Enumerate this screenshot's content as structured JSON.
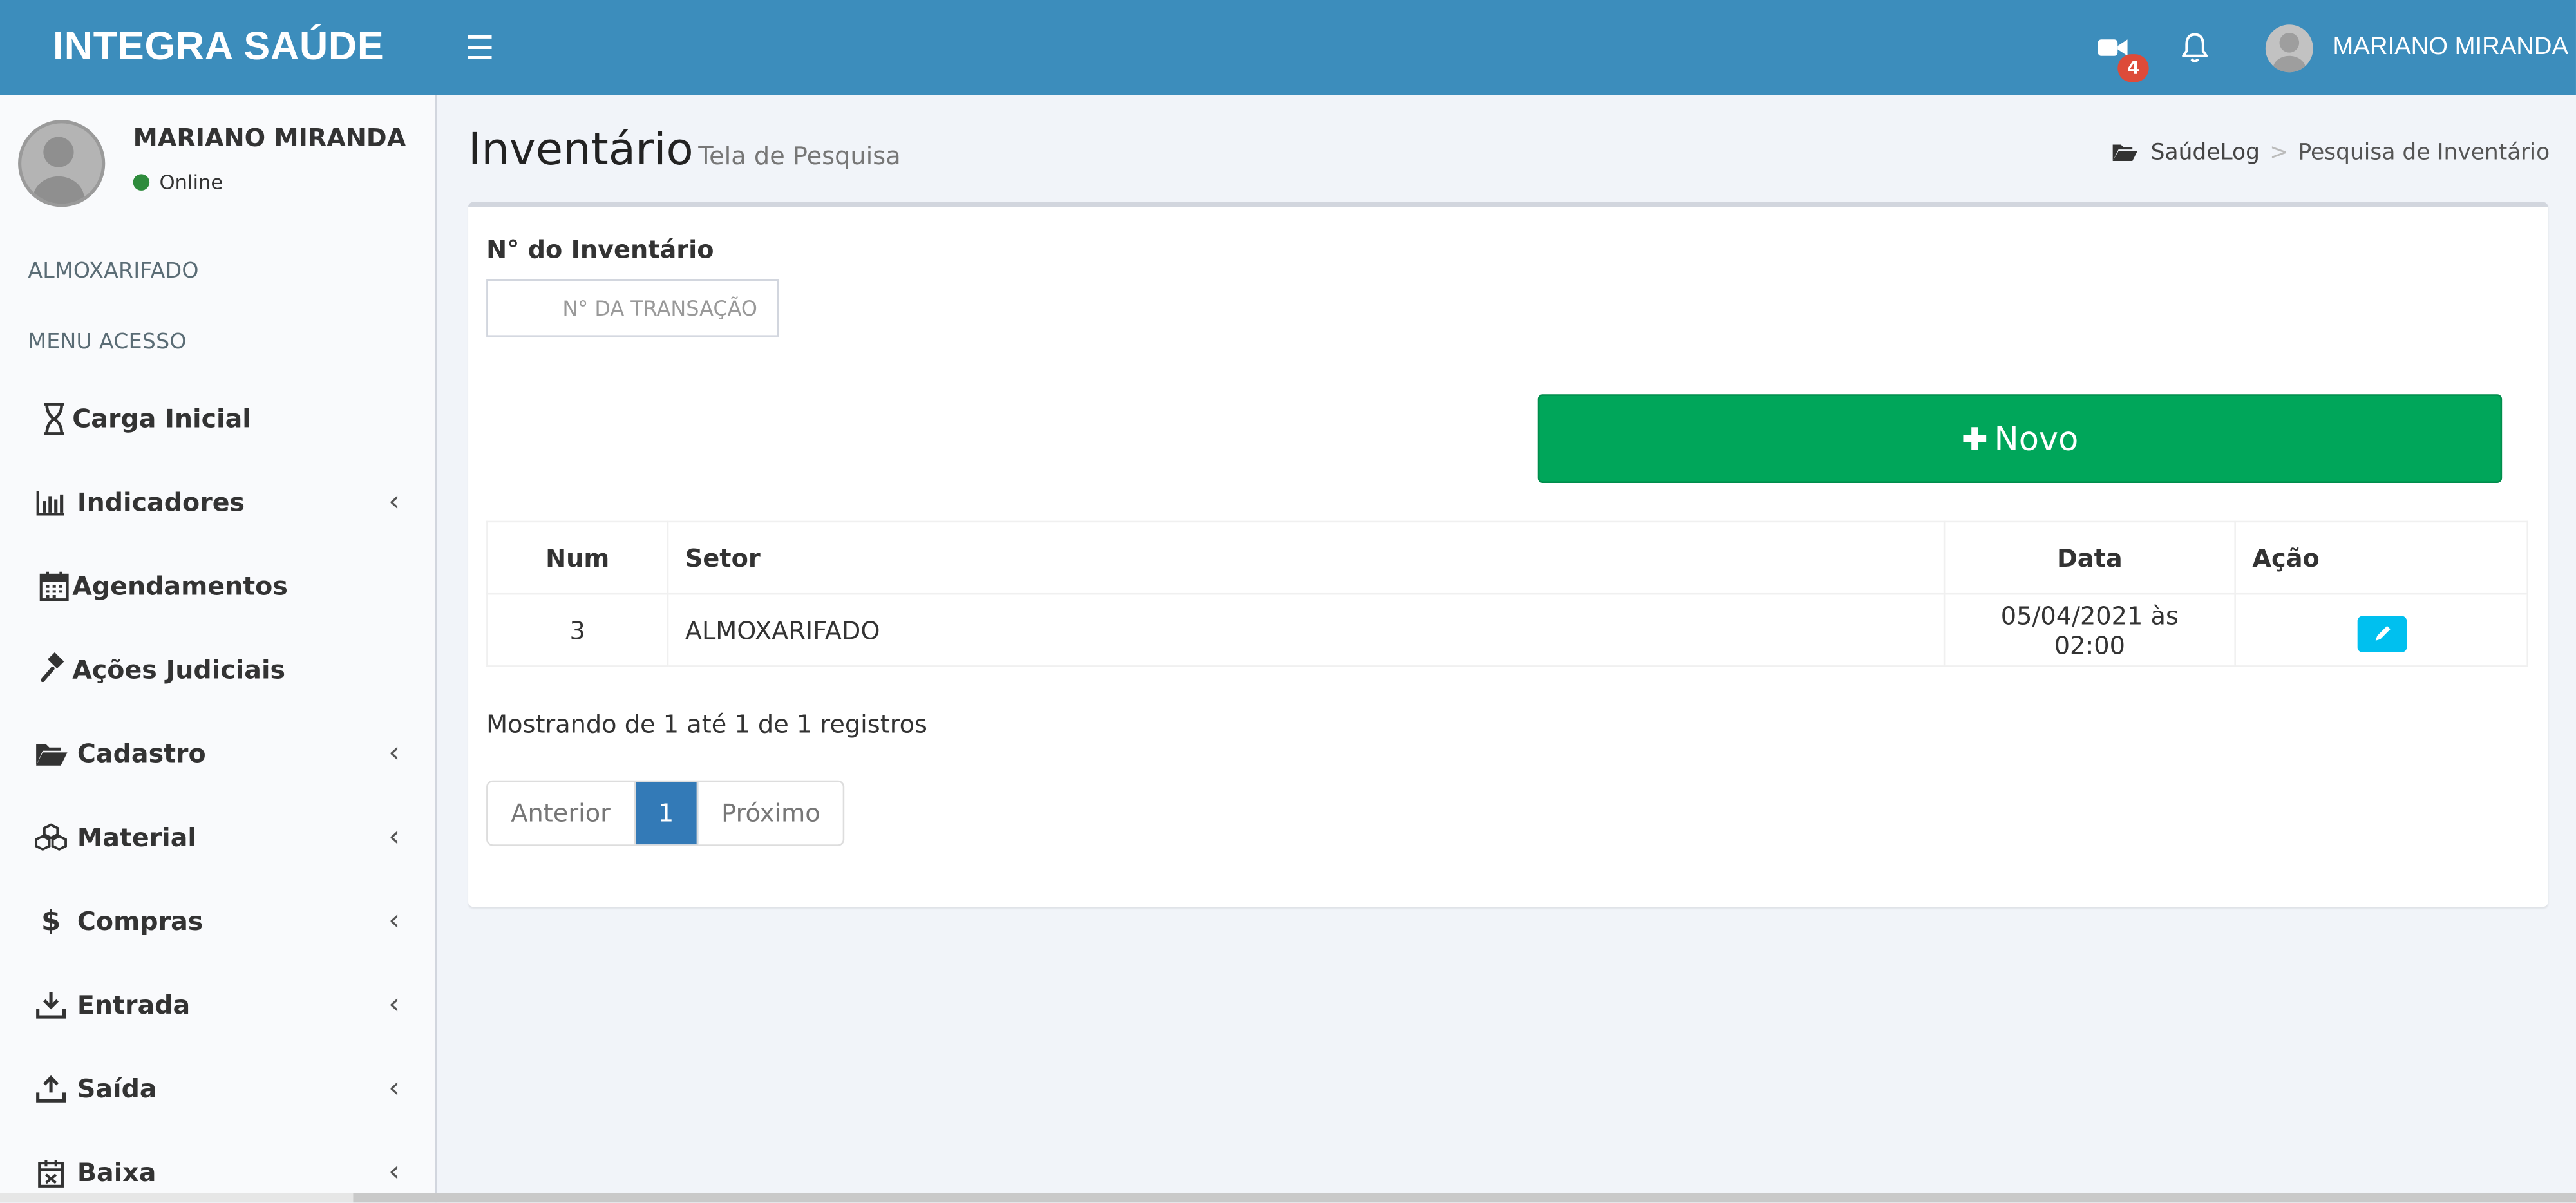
{
  "header": {
    "logo": "INTEGRA SAÚDE",
    "video_badge": "4",
    "user_name": "MARIANO MIRANDA"
  },
  "sidebar": {
    "user_name": "MARIANO MIRANDA",
    "status": "Online",
    "section_1": "ALMOXARIFADO",
    "section_2": "MENU ACESSO",
    "items": [
      {
        "label": "Carga Inicial",
        "icon": "hourglass-icon",
        "expandable": false
      },
      {
        "label": "Indicadores",
        "icon": "bar-chart-icon",
        "expandable": true
      },
      {
        "label": "Agendamentos",
        "icon": "calendar-icon",
        "expandable": false
      },
      {
        "label": "Ações Judiciais",
        "icon": "gavel-icon",
        "expandable": false
      },
      {
        "label": "Cadastro",
        "icon": "folder-open-icon",
        "expandable": true
      },
      {
        "label": "Material",
        "icon": "cubes-icon",
        "expandable": true
      },
      {
        "label": "Compras",
        "icon": "dollar-icon",
        "expandable": true
      },
      {
        "label": "Entrada",
        "icon": "download-icon",
        "expandable": true
      },
      {
        "label": "Saída",
        "icon": "upload-icon",
        "expandable": true
      },
      {
        "label": "Baixa",
        "icon": "calendar-x-icon",
        "expandable": true
      }
    ]
  },
  "page": {
    "title": "Inventário",
    "subtitle": "Tela de Pesquisa",
    "breadcrumb_home": "SaúdeLog",
    "breadcrumb_current": "Pesquisa de Inventário"
  },
  "form": {
    "label": "N° do Inventário",
    "placeholder": "N° DA TRANSAÇÃO",
    "value": "",
    "new_button": "Novo"
  },
  "table": {
    "columns": [
      "Num",
      "Setor",
      "Data",
      "Ação"
    ],
    "rows": [
      {
        "num": "3",
        "setor": "ALMOXARIFADO",
        "data": "05/04/2021 às 02:00"
      }
    ]
  },
  "pagination": {
    "info": "Mostrando de 1 até 1 de 1 registros",
    "prev": "Anterior",
    "current": "1",
    "next": "Próximo"
  },
  "colors": {
    "header": "#3c8dbc",
    "success": "#00a65a",
    "info": "#00c0ef",
    "primary": "#337ab7",
    "badge": "#dd4b39"
  }
}
